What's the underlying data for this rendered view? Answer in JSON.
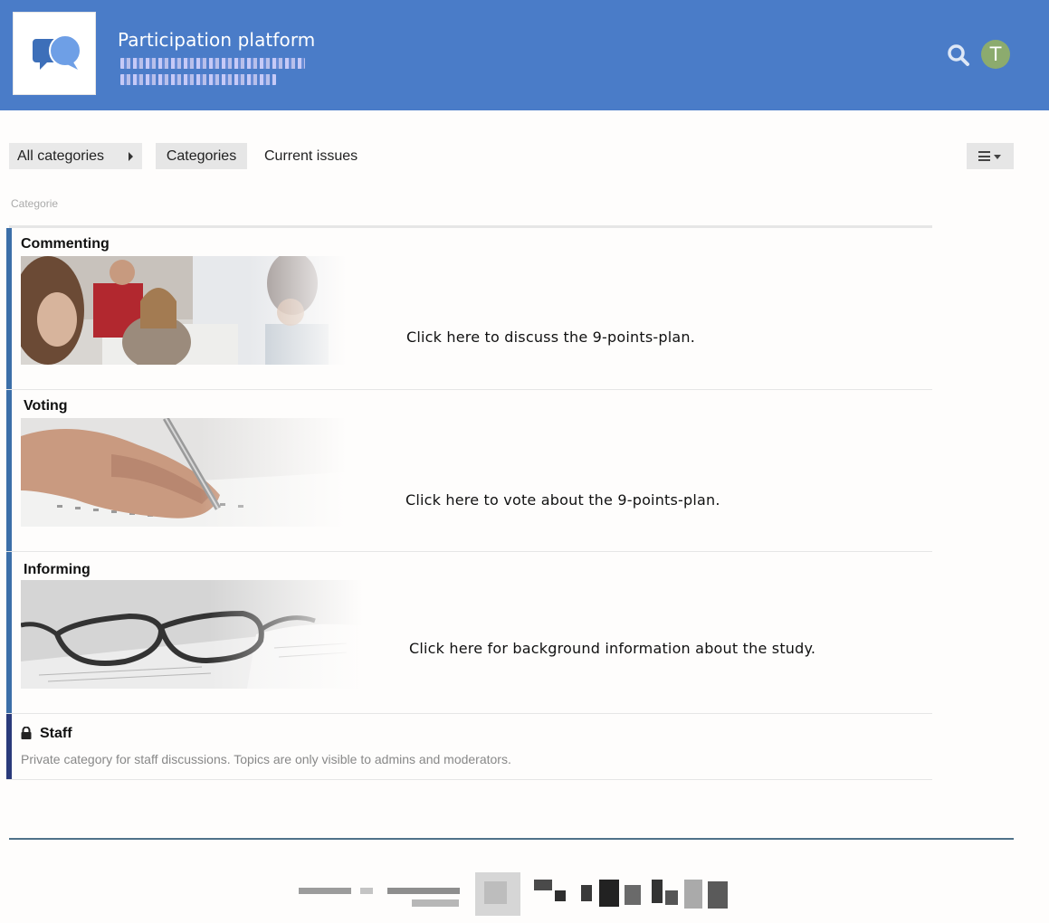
{
  "header": {
    "title": "Participation platform",
    "colors": {
      "header_bg": "#4a7cc8",
      "avatar_bg": "#8cab6e"
    },
    "avatar_letter": "T",
    "icons": {
      "logo": "speech-bubbles-logo",
      "search": "search-icon"
    }
  },
  "nav": {
    "all_categories": "All categories",
    "categories": "Categories",
    "current_issues": "Current issues"
  },
  "table": {
    "column_label": "Categorie"
  },
  "categories": [
    {
      "name": "Commenting",
      "description": "Click here to discuss the 9-points-plan.",
      "color": "#3c6fa8",
      "image": "people-meeting-photo"
    },
    {
      "name": "Voting",
      "description": "Click here to vote about the 9-points-plan.",
      "color": "#3c6fa8",
      "image": "hand-writing-ballot-photo"
    },
    {
      "name": "Informing",
      "description": "Click here for background information about the study.",
      "color": "#3c6fa8",
      "image": "glasses-on-book-photo"
    },
    {
      "name": "Staff",
      "description": "Private category for staff discussions. Topics are only visible to admins and moderators.",
      "color": "#2a3a7a",
      "icon": "lock-icon"
    }
  ]
}
